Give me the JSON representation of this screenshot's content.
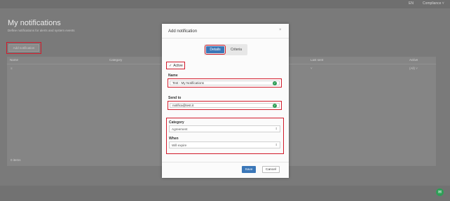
{
  "topbar": {
    "flag_label": "EN",
    "user_label": "Compliance ˅"
  },
  "page": {
    "title": "My notifications",
    "subtitle": "Define notifications for alerts and system events",
    "add_button": "Add notification",
    "item_count": "0 items"
  },
  "table": {
    "columns": [
      "Name",
      "Category",
      "Last sent",
      "Active"
    ],
    "filters": {
      "name": "≡",
      "last_sent": "˅",
      "active": "(All) ˅"
    }
  },
  "modal": {
    "title": "Add notification",
    "close_icon": "×",
    "tabs": [
      {
        "label": "Details",
        "selected": true
      },
      {
        "label": "Criteria",
        "selected": false
      }
    ],
    "active": {
      "checked": true,
      "label": "Active"
    },
    "name": {
      "label": "Name",
      "value": "Test - My Notifications"
    },
    "send_to": {
      "label": "Send to",
      "value": "notifica@test.it"
    },
    "category": {
      "label": "Category",
      "value": "Agreement"
    },
    "when": {
      "label": "When",
      "value": "Will expire"
    },
    "save_label": "Save",
    "cancel_label": "Cancel"
  },
  "colors": {
    "primary": "#3b77b8",
    "highlight_border": "#d21b2b",
    "success": "#2f9e57",
    "overlay": "#7a7a7a"
  },
  "icons": {
    "check": "check-icon",
    "valid": "valid-check-icon",
    "close": "close-icon",
    "chevron": "chevron-down-icon",
    "chat": "chat-icon"
  }
}
